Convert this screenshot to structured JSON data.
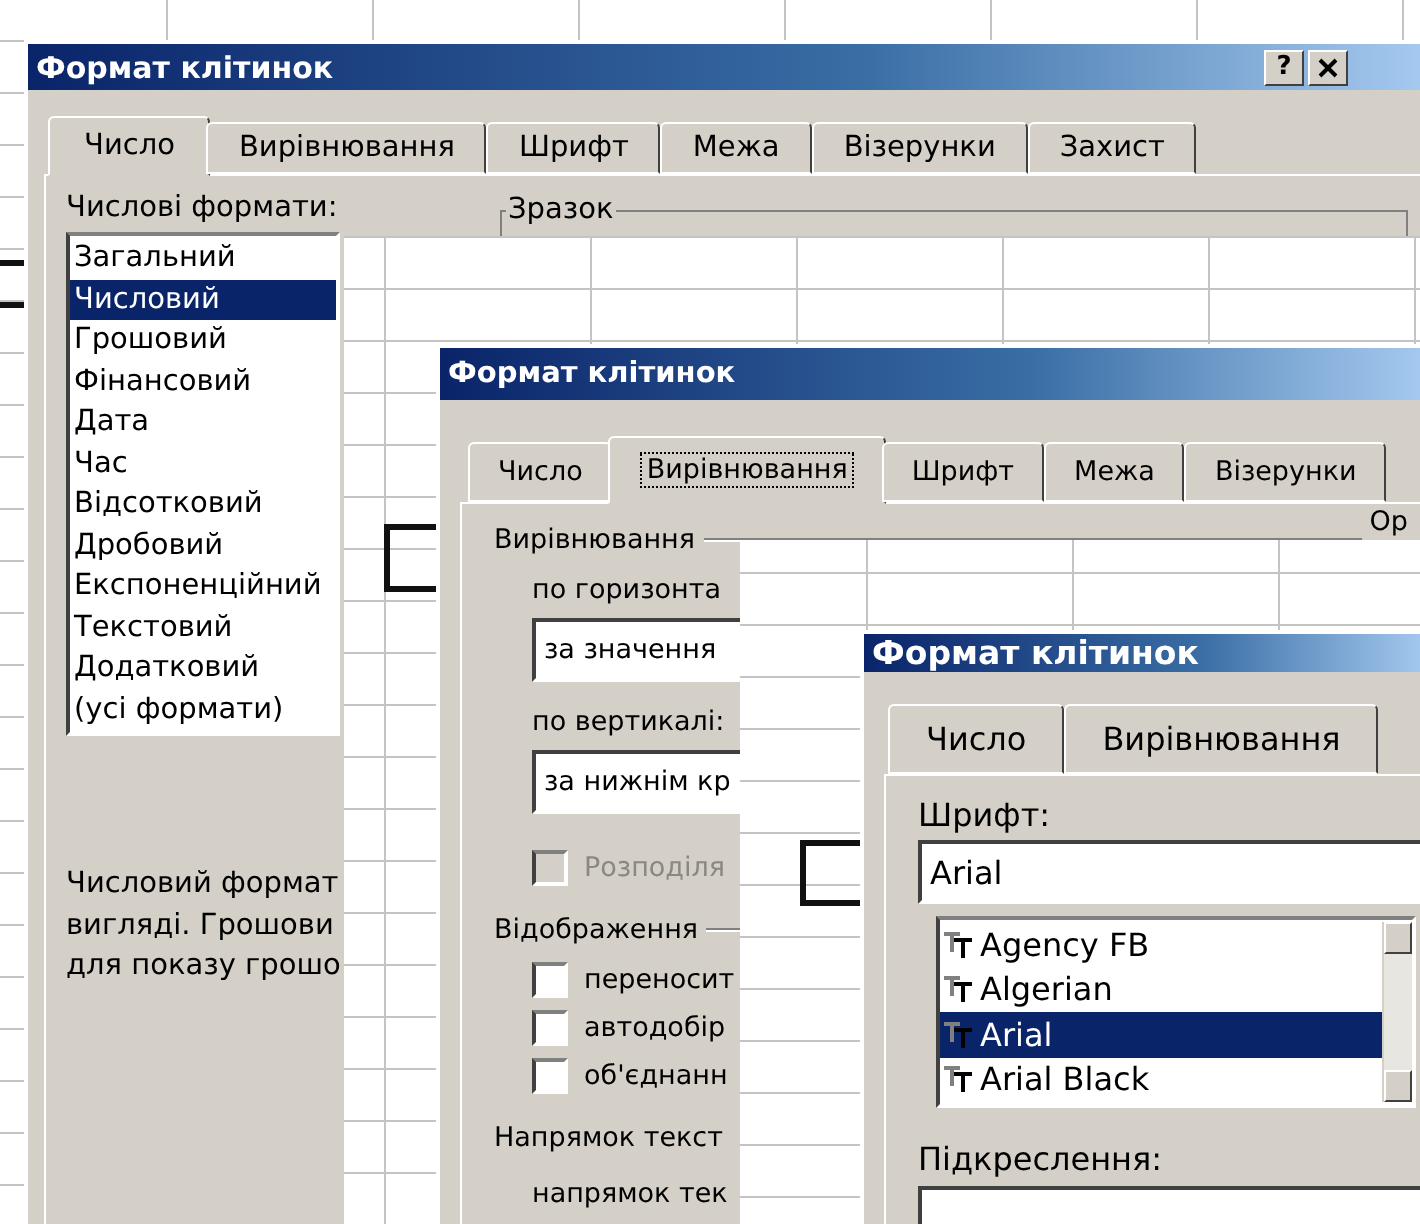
{
  "number_dialog": {
    "title": "Формат клітинок",
    "help_button": "?",
    "tabs": [
      {
        "label": "Число",
        "selected": true
      },
      {
        "label": "Вирівнювання",
        "selected": false
      },
      {
        "label": "Шрифт",
        "selected": false
      },
      {
        "label": "Межа",
        "selected": false
      },
      {
        "label": "Візерунки",
        "selected": false
      },
      {
        "label": "Захист",
        "selected": false
      }
    ],
    "formats_label": "Числові формати:",
    "sample_label": "Зразок",
    "formats": [
      {
        "label": "Загальний",
        "selected": false
      },
      {
        "label": "Числовий",
        "selected": true
      },
      {
        "label": "Грошовий",
        "selected": false
      },
      {
        "label": "Фінансовий",
        "selected": false
      },
      {
        "label": "Дата",
        "selected": false
      },
      {
        "label": "Час",
        "selected": false
      },
      {
        "label": "Відсотковий",
        "selected": false
      },
      {
        "label": "Дробовий",
        "selected": false
      },
      {
        "label": "Експоненційний",
        "selected": false
      },
      {
        "label": "Текстовий",
        "selected": false
      },
      {
        "label": "Додатковий",
        "selected": false
      },
      {
        "label": "(усі формати)",
        "selected": false
      }
    ],
    "description": [
      "Числовий формат",
      "вигляді. Грошови",
      "для показу грошо"
    ]
  },
  "alignment_dialog": {
    "title": "Формат клітинок",
    "tabs": [
      {
        "label": "Число",
        "selected": false
      },
      {
        "label": "Вирівнювання",
        "selected": true
      },
      {
        "label": "Шрифт",
        "selected": false
      },
      {
        "label": "Межа",
        "selected": false
      },
      {
        "label": "Візерунки",
        "selected": false
      }
    ],
    "alignment_label": "Вирівнювання",
    "orientation_label": "Ор",
    "horizontal_label": "по горизонта",
    "horizontal_value": "за значення",
    "vertical_label": "по вертикалі:",
    "vertical_value": "за нижнім кр",
    "display_label": "Відображення",
    "alignment_checkboxes": [
      {
        "label": "Розподіля",
        "checked": false,
        "disabled": true
      }
    ],
    "display_checkboxes": [
      {
        "label": "переносит",
        "checked": false,
        "disabled": false
      },
      {
        "label": "автодобір",
        "checked": false,
        "disabled": false
      },
      {
        "label": "об'єднанн",
        "checked": false,
        "disabled": false
      }
    ],
    "direction_label": "Напрямок текст",
    "direction_sublabel": "напрямок тек"
  },
  "font_dialog": {
    "title": "Формат клітинок",
    "tabs": [
      {
        "label": "Число",
        "selected": false
      },
      {
        "label": "Вирівнювання",
        "selected": false
      }
    ],
    "font_label": "Шрифт:",
    "font_value": "Arial",
    "fonts": [
      {
        "label": "Agency FB",
        "selected": false
      },
      {
        "label": "Algerian",
        "selected": false
      },
      {
        "label": "Arial",
        "selected": true
      },
      {
        "label": "Arial Black",
        "selected": false
      }
    ],
    "underline_label": "Підкреслення:"
  }
}
